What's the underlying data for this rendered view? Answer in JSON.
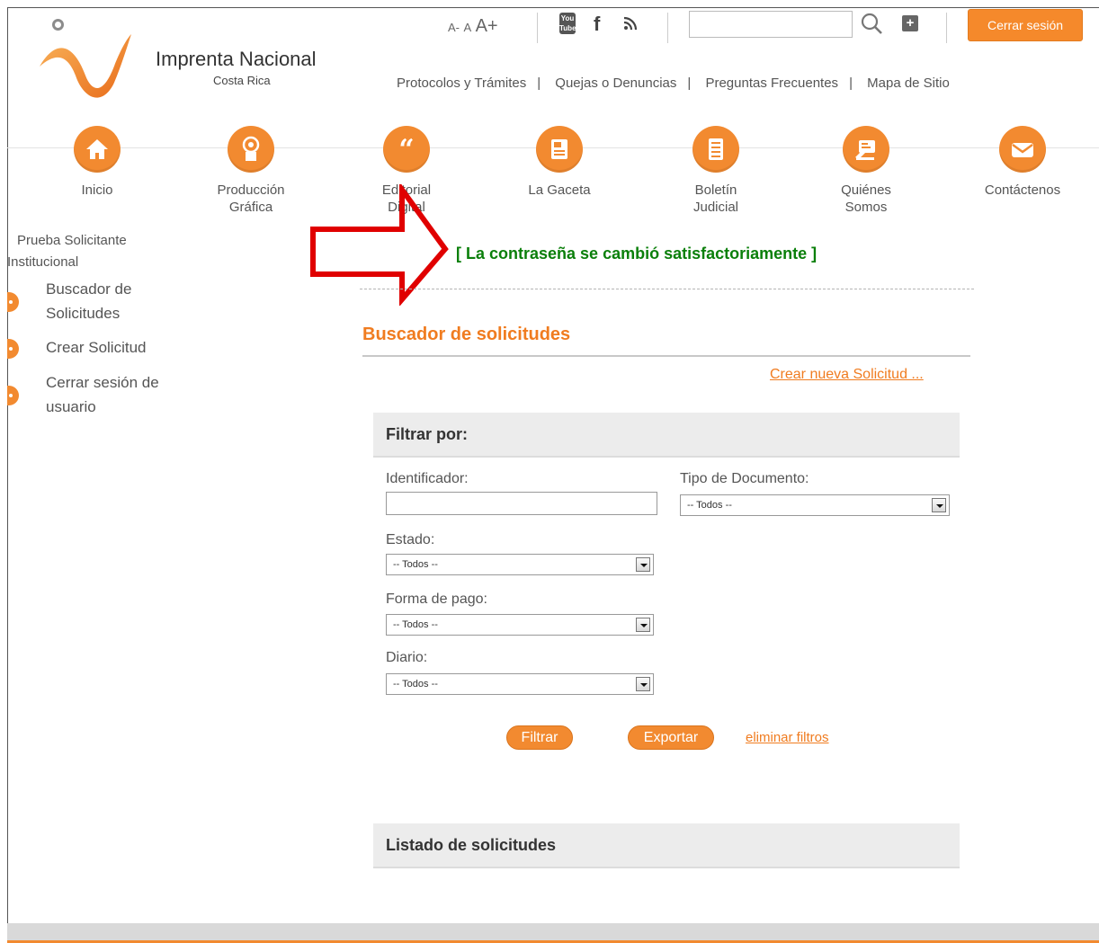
{
  "header": {
    "brand": "Imprenta Nacional",
    "brand_sub": "Costa Rica",
    "font_small": "A-",
    "font_normal": "A",
    "font_large": "A+",
    "youtube": "You Tube",
    "logout": "Cerrar sesión",
    "search_value": "",
    "links": [
      "Protocolos y Trámites",
      "Quejas o Denuncias",
      "Preguntas Frecuentes",
      "Mapa de Sitio"
    ]
  },
  "nav": [
    {
      "label": "Inicio",
      "icon": "home-icon"
    },
    {
      "label": "Producción Gráfica",
      "icon": "print-icon"
    },
    {
      "label": "Editorial Digital",
      "icon": "quote-icon"
    },
    {
      "label": "La Gaceta",
      "icon": "newspaper-icon"
    },
    {
      "label": "Boletín Judicial",
      "icon": "document-icon"
    },
    {
      "label": "Quiénes Somos",
      "icon": "about-icon"
    },
    {
      "label": "Contáctenos",
      "icon": "mail-icon"
    }
  ],
  "sidebar": {
    "user": "Prueba Solicitante Institucional",
    "items": [
      "Buscador de Solicitudes",
      "Crear Solicitud",
      "Cerrar sesión de usuario"
    ]
  },
  "message": "[ La contraseña se cambió satisfactoriamente ]",
  "main": {
    "title": "Buscador de solicitudes",
    "create_link": "Crear nueva Solicitud ...",
    "filter_title": "Filtrar por:",
    "identificador_label": "Identificador:",
    "identificador_value": "",
    "tipo_label": "Tipo de Documento:",
    "tipo_value": "-- Todos --",
    "estado_label": "Estado:",
    "estado_value": "-- Todos --",
    "forma_label": "Forma de pago:",
    "forma_value": "-- Todos --",
    "diario_label": "Diario:",
    "diario_value": "-- Todos --",
    "filter_button": "Filtrar",
    "export_button": "Exportar",
    "clear_filters": "eliminar filtros",
    "list_title": "Listado de solicitudes"
  },
  "colors": {
    "accent": "#f28a30",
    "success": "#0a7f0a",
    "arrow": "#e00000"
  }
}
